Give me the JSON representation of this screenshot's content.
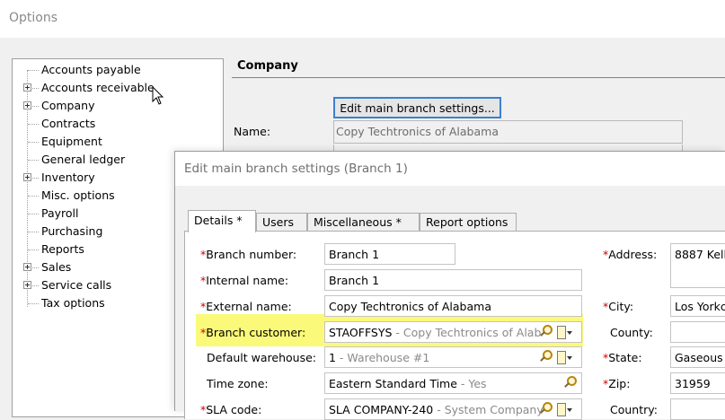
{
  "window": {
    "title": "Options"
  },
  "tree": {
    "items": [
      {
        "label": "Accounts payable",
        "expandable": false
      },
      {
        "label": "Accounts receivable",
        "expandable": true
      },
      {
        "label": "Company",
        "expandable": true
      },
      {
        "label": "Contracts",
        "expandable": false
      },
      {
        "label": "Equipment",
        "expandable": false
      },
      {
        "label": "General ledger",
        "expandable": false
      },
      {
        "label": "Inventory",
        "expandable": true
      },
      {
        "label": "Misc. options",
        "expandable": false
      },
      {
        "label": "Payroll",
        "expandable": false
      },
      {
        "label": "Purchasing",
        "expandable": false
      },
      {
        "label": "Reports",
        "expandable": false
      },
      {
        "label": "Sales",
        "expandable": true
      },
      {
        "label": "Service calls",
        "expandable": true
      },
      {
        "label": "Tax options",
        "expandable": false
      }
    ]
  },
  "company": {
    "header": "Company",
    "edit_button": "Edit main branch settings...",
    "name_label": "Name:",
    "name_value": "Copy Techtronics of Alabama"
  },
  "dialog": {
    "title": "Edit main branch settings (Branch 1)",
    "tabs": [
      "Details *",
      "Users",
      "Miscellaneous *",
      "Report options"
    ],
    "fields": {
      "branch_number": {
        "label": "Branch number:",
        "value": "Branch 1"
      },
      "internal_name": {
        "label": "Internal name:",
        "value": "Branch 1"
      },
      "external_name": {
        "label": "External name:",
        "value": "Copy Techtronics of Alabama"
      },
      "branch_customer": {
        "label": "Branch customer:",
        "code": "STAOFFSYS",
        "desc": " - Copy Techtronics of Alab"
      },
      "default_warehouse": {
        "label": "Default warehouse:",
        "code": "1",
        "desc": " - Warehouse #1"
      },
      "time_zone": {
        "label": "Time zone:",
        "code": "Eastern Standard Time",
        "desc": " - Yes"
      },
      "sla_code": {
        "label": "SLA code:",
        "code": "SLA COMPANY-240",
        "desc": " - System Company"
      },
      "address": {
        "label": "Address:",
        "value": "8887 Kell"
      },
      "city": {
        "label": "City:",
        "value": "Los Yorkca"
      },
      "county": {
        "label": "County:",
        "value": ""
      },
      "state": {
        "label": "State:",
        "value": "Gaseous"
      },
      "zip": {
        "label": "Zip:",
        "value": "31959"
      },
      "country": {
        "label": "Country:",
        "value": ""
      }
    },
    "required_mark": "*"
  },
  "colors": {
    "highlight": "#fbf97a",
    "required": "#cc0000",
    "accent": "#3c7fd1"
  }
}
